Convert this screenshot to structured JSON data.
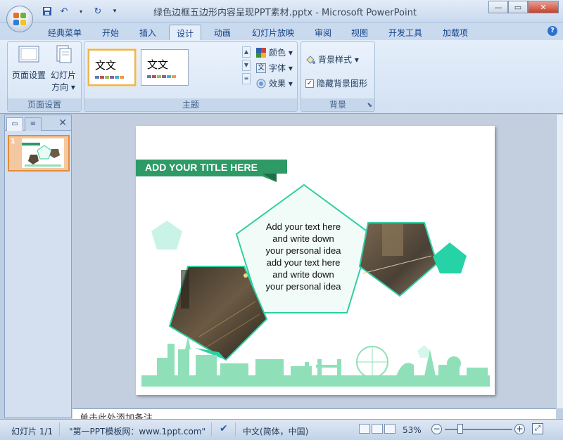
{
  "window": {
    "title": "绿色边框五边形内容呈现PPT素材.pptx - Microsoft PowerPoint",
    "minimize": "—",
    "maximize": "▭",
    "close": "✕"
  },
  "tabs": [
    "经典菜单",
    "开始",
    "插入",
    "设计",
    "动画",
    "幻灯片放映",
    "审阅",
    "视图",
    "开发工具",
    "加载项"
  ],
  "active_tab": "设计",
  "ribbon": {
    "page_setup_group": {
      "label": "页面设置",
      "page_setup_btn": "页面设置",
      "orientation_btn_line1": "幻灯片",
      "orientation_btn_line2": "方向 ▾"
    },
    "theme_group": {
      "label": "主题",
      "theme1_text": "文文",
      "theme2_text": "文文",
      "colors": "颜色 ▾",
      "fonts": "字体 ▾",
      "effects": "效果 ▾"
    },
    "background_group": {
      "label": "背景",
      "bg_styles": "背景样式 ▾",
      "hide_bg_graphics": "隐藏背景图形",
      "hide_bg_checked": true
    }
  },
  "slides_pane": {
    "slide_number": "1"
  },
  "slide": {
    "title": "ADD YOUR TITLE HERE",
    "body_lines": [
      "Add your text here",
      "and write down",
      "your personal idea",
      "add your text here",
      "and write down",
      "your personal idea"
    ],
    "accent_color": "#2e9a66",
    "outline_color": "#2ecfa0",
    "mint_color": "#a8ecd9",
    "skyline_color": "#8fe0b9"
  },
  "notes": {
    "placeholder": "单击此处添加备注"
  },
  "status": {
    "slide_info": "幻灯片 1/1",
    "theme_name": "\"第一PPT模板网：www.1ppt.com\"",
    "language": "中文(简体，中国)",
    "zoom": "53%"
  }
}
